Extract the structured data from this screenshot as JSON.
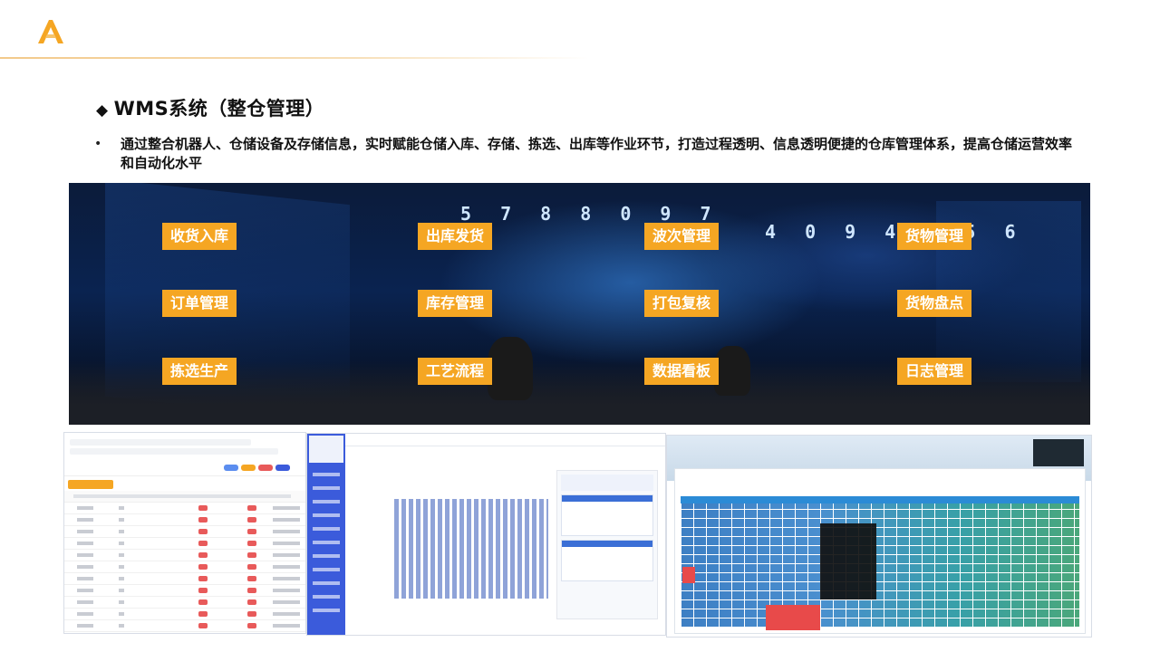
{
  "brand": {
    "logo_icon": "peak-logo-icon",
    "accent": "#f5a623"
  },
  "section": {
    "marker": "◆",
    "title": "WMS系统（整仓管理）"
  },
  "description": {
    "bullet": "•",
    "text": "通过整合机器人、仓储设备及存储信息，实时赋能仓储入库、存储、拣选、出库等作业环节，打造过程透明、信息透明便捷的仓库管理体系，提高仓储运营效率和自动化水平"
  },
  "banner": {
    "counter_left": "5 7 8 8 0 9 7",
    "counter_right": "4 0 9 4 0 5 6",
    "features": [
      {
        "label": "收货入库"
      },
      {
        "label": "出库发货"
      },
      {
        "label": "波次管理"
      },
      {
        "label": "货物管理"
      },
      {
        "label": "订单管理"
      },
      {
        "label": "库存管理"
      },
      {
        "label": "打包复核"
      },
      {
        "label": "货物盘点"
      },
      {
        "label": "拣选生产"
      },
      {
        "label": "工艺流程"
      },
      {
        "label": "数据看板"
      },
      {
        "label": "日志管理"
      }
    ]
  },
  "colors": {
    "tag_bg": "#f5a623",
    "sidebar_blue": "#3b5bdb",
    "status_red": "#e85a5a",
    "table_blue": "#2b8bd6"
  }
}
